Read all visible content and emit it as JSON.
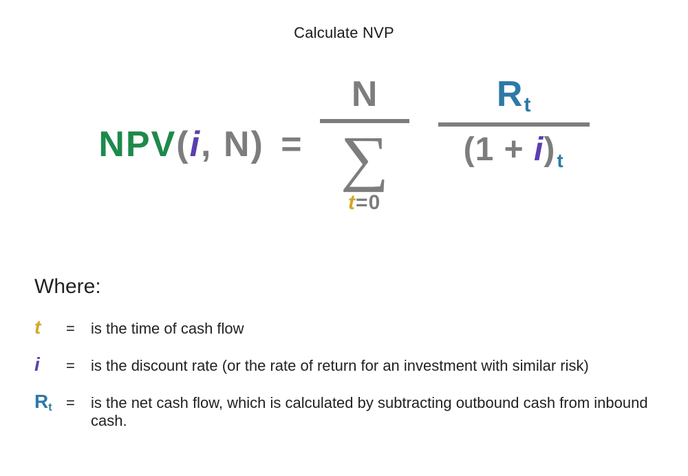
{
  "title": "Calculate NVP",
  "formula": {
    "lhs": {
      "npv": "NPV",
      "i": "i",
      "n": "N"
    },
    "sum": {
      "upper": "N",
      "sigma": "∑",
      "lower_t": "t",
      "lower_eq": "=0"
    },
    "frac": {
      "num_R": "R",
      "num_sub": "t",
      "den_open": "(1 + ",
      "den_i": "i",
      "den_close": ")",
      "den_sub": "t"
    }
  },
  "legend": {
    "where": "Where:",
    "rows": [
      {
        "sym": "t",
        "sym_sub": "",
        "color": "t",
        "text": "is the time of cash flow"
      },
      {
        "sym": "i",
        "sym_sub": "",
        "color": "i",
        "text": "is the discount rate (or the rate of return for an investment with similar risk)"
      },
      {
        "sym": "R",
        "sym_sub": "t",
        "color": "r",
        "text": "is the net cash flow, which is calculated by subtracting outbound cash from inbound cash."
      }
    ]
  },
  "colors": {
    "green": "#1d8a4a",
    "gray": "#7d7d7d",
    "purple": "#5c3fb0",
    "blue": "#2d79a6",
    "gold": "#d4a62a"
  }
}
